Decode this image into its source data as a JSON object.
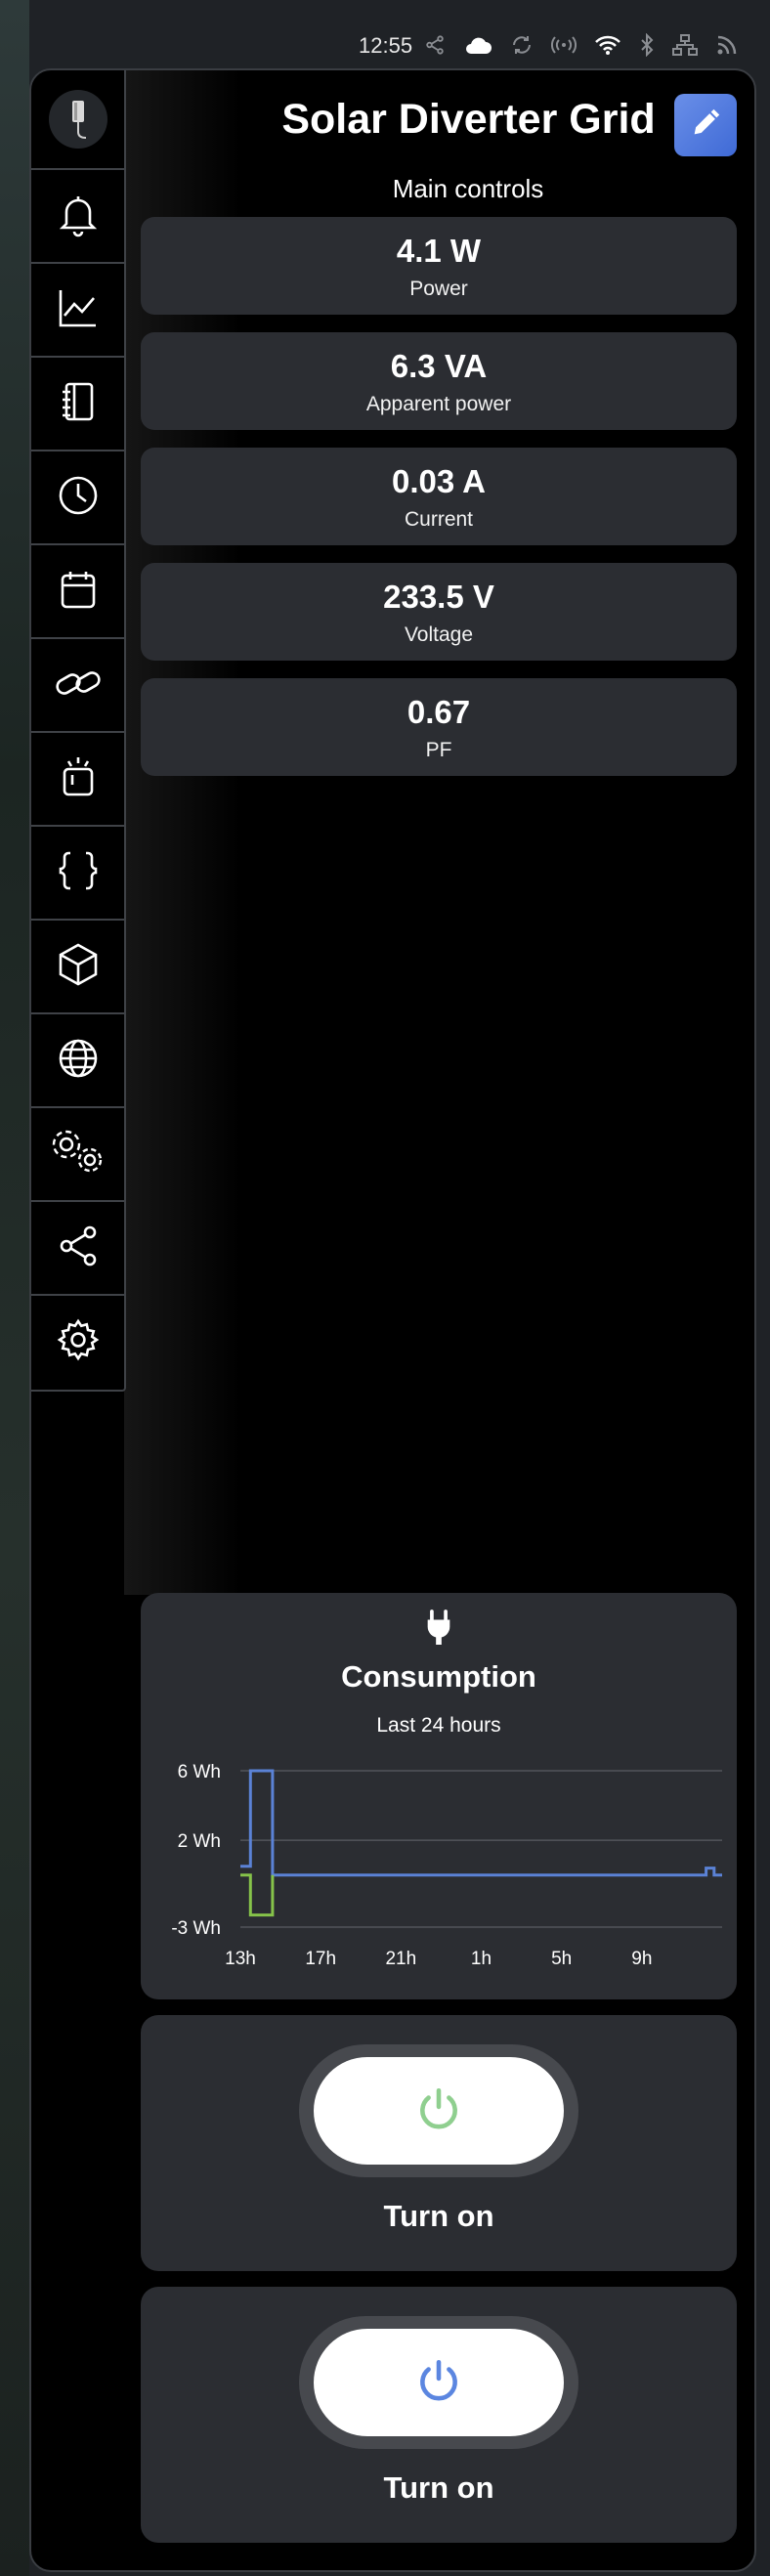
{
  "status_bar": {
    "time": "12:55",
    "icons": [
      "share-icon",
      "cloud-icon",
      "sync-icon",
      "signal-icon",
      "wifi-icon",
      "bluetooth-icon",
      "network-icon",
      "rss-icon"
    ]
  },
  "header": {
    "title": "Solar Diverter Grid",
    "edit_icon": "pencil-icon",
    "accent": "#4a78e0"
  },
  "sidebar": {
    "items": [
      {
        "name": "notifications",
        "icon": "bell-icon"
      },
      {
        "name": "history",
        "icon": "chart-line-icon"
      },
      {
        "name": "logbook",
        "icon": "notebook-icon"
      },
      {
        "name": "automations",
        "icon": "clock-icon"
      },
      {
        "name": "calendar",
        "icon": "calendar-icon"
      },
      {
        "name": "integrations",
        "icon": "link-icon"
      },
      {
        "name": "devices",
        "icon": "device-icon"
      },
      {
        "name": "scripts",
        "icon": "braces-icon"
      },
      {
        "name": "entities",
        "icon": "cube-icon"
      },
      {
        "name": "network",
        "icon": "globe-icon"
      },
      {
        "name": "system",
        "icon": "cogs-icon"
      },
      {
        "name": "sharing",
        "icon": "share-icon"
      },
      {
        "name": "settings",
        "icon": "gear-icon"
      }
    ]
  },
  "main": {
    "section_label": "Main controls",
    "metrics": [
      {
        "value": "4.1 W",
        "label": "Power"
      },
      {
        "value": "6.3 VA",
        "label": "Apparent power"
      },
      {
        "value": "0.03 A",
        "label": "Current"
      },
      {
        "value": "233.5 V",
        "label": "Voltage"
      },
      {
        "value": "0.67",
        "label": "PF"
      }
    ]
  },
  "consumption_card": {
    "icon": "plug-icon",
    "title": "Consumption",
    "subtitle": "Last 24 hours"
  },
  "chart_data": {
    "type": "line",
    "title": "Consumption",
    "subtitle": "Last 24 hours",
    "x_tick_labels": [
      "13h",
      "17h",
      "21h",
      "1h",
      "5h",
      "9h"
    ],
    "y_tick_labels": [
      "6 Wh",
      "2 Wh",
      "-3 Wh"
    ],
    "ylim": [
      -3,
      6
    ],
    "y_ticks": [
      6,
      2,
      -3
    ],
    "x_hours_range": [
      13,
      37
    ],
    "grid": true,
    "series": [
      {
        "color": "#5b82d6",
        "points": [
          [
            13,
            0.5
          ],
          [
            13.5,
            0.5
          ],
          [
            13.5,
            6
          ],
          [
            14.6,
            6
          ],
          [
            14.6,
            0
          ],
          [
            36.2,
            0
          ],
          [
            36.2,
            0.4
          ],
          [
            36.6,
            0.4
          ],
          [
            36.6,
            0
          ],
          [
            37,
            0
          ]
        ]
      },
      {
        "color": "#86c34a",
        "points": [
          [
            13,
            0
          ],
          [
            13.5,
            0
          ],
          [
            13.5,
            -2.3
          ],
          [
            14.6,
            -2.3
          ],
          [
            14.6,
            0
          ]
        ]
      }
    ]
  },
  "switches": [
    {
      "label": "Turn on",
      "icon": "power-icon",
      "icon_color": "#8fcf8f"
    },
    {
      "label": "Turn on",
      "icon": "power-icon",
      "icon_color": "#5b86e0"
    }
  ]
}
